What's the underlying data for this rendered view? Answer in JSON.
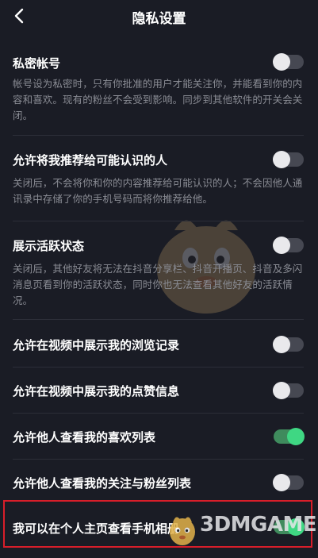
{
  "header": {
    "title": "隐私设置",
    "back_icon": "chevron-left-icon"
  },
  "settings": [
    {
      "title": "私密帐号",
      "description": "帐号设为私密时，只有你批准的用户才能关注你，并能看到你的内容和喜欢。现有的粉丝不会受到影响。同步到其他软件的开关会关闭。",
      "enabled": false
    },
    {
      "title": "允许将我推荐给可能认识的人",
      "description": "关闭后，不会将你和你的内容推荐给可能认识的人；不会因他人通讯录中存储了你的手机号码而将你推荐给他。",
      "enabled": false
    },
    {
      "title": "展示活跃状态",
      "description": "关闭后，其他好友将无法在抖音分享栏、抖音开播页、抖音及多闪消息页看到你的活跃状态，同时你也无法查看其他好友的活跃情况。",
      "enabled": false
    },
    {
      "title": "允许在视频中展示我的浏览记录",
      "enabled": false
    },
    {
      "title": "允许在视频中展示我的点赞信息",
      "enabled": false
    },
    {
      "title": "允许他人查看我的喜欢列表",
      "enabled": true
    },
    {
      "title": "允许他人查看我的关注与粉丝列表",
      "enabled": false
    },
    {
      "title": "我可以在个人主页查看手机相册",
      "enabled": true
    }
  ],
  "watermark": {
    "text": "3DMGAME"
  },
  "colors": {
    "background": "#1a1c25",
    "toggle_on": "#3fd783",
    "toggle_off": "#464852",
    "highlight": "#d81e2a",
    "description": "#8a8c94"
  }
}
